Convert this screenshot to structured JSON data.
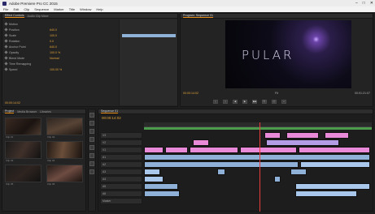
{
  "window": {
    "title": "Adobe Premiere Pro CC 2015",
    "controls": [
      "–",
      "□",
      "✕"
    ]
  },
  "menu": [
    "File",
    "Edit",
    "Clip",
    "Sequence",
    "Marker",
    "Title",
    "Window",
    "Help"
  ],
  "effect_controls": {
    "tabs": [
      "Effect Controls",
      "Audio Clip Mixer"
    ],
    "rows": [
      {
        "label": "Motion",
        "value": ""
      },
      {
        "label": "Position",
        "value": "640.0"
      },
      {
        "label": "Scale",
        "value": "100.0"
      },
      {
        "label": "Rotation",
        "value": "0.0"
      },
      {
        "label": "Anchor Point",
        "value": "640.0"
      },
      {
        "label": "Opacity",
        "value": "100.0 %"
      },
      {
        "label": "Blend Mode",
        "value": "Normal"
      },
      {
        "label": "Time Remapping",
        "value": ""
      },
      {
        "label": "Speed",
        "value": "100.00 %"
      }
    ],
    "timecode": "00:00:14:02"
  },
  "program_monitor": {
    "tab": "Program: Sequence 01",
    "clip_title": "PULAR",
    "timecode": "00:00:14:02",
    "fit": "Fit",
    "duration": "00:01:21:07",
    "controls": [
      "{",
      "}",
      "◀",
      "▶",
      "▶▶",
      "⎘",
      "⎙",
      "+"
    ]
  },
  "project": {
    "tabs": [
      "Project",
      "Media Browser",
      "Libraries"
    ],
    "items": [
      "Clip 01",
      "Clip 02",
      "Clip 03",
      "Clip 04",
      "Clip 05",
      "Clip 06"
    ]
  },
  "timeline": {
    "tab": "Sequence 01",
    "timecode": "00:00:14:02",
    "tracks": [
      "V3",
      "V2",
      "V1",
      "A1",
      "A2",
      "A3",
      "A4",
      "A5",
      "A6",
      "Master"
    ]
  },
  "colors": {
    "accent": "#e88f1d",
    "timecode": "#e0a23a",
    "video_clip": "#e98ad9",
    "audio_clip": "#8fb1d7",
    "playhead": "#ea3b3b"
  }
}
